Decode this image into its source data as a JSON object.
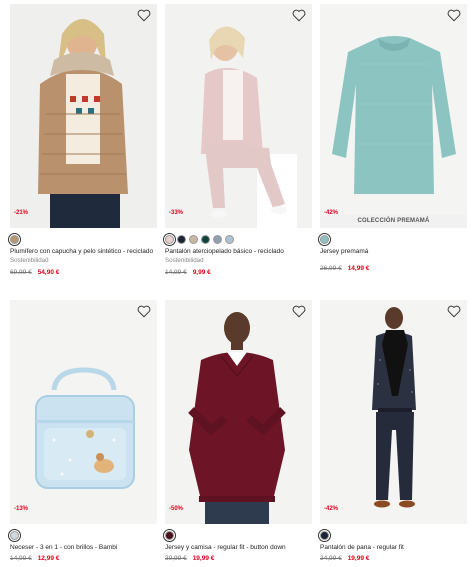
{
  "colors": {
    "sale": "#e3001b",
    "muted": "#888888"
  },
  "products": [
    {
      "name": "Plumífero con capucha y pelo sintético - reciclado",
      "tag": "Sostenibilidad",
      "discount": "-21%",
      "old_price": "69,99 €",
      "new_price": "54,90 €",
      "swatches": [
        "#b99570"
      ],
      "banner": "",
      "icon": "heart-icon"
    },
    {
      "name": "Pantalón aterciopelado básico - reciclado",
      "tag": "Sostenibilidad",
      "discount": "-33%",
      "old_price": "14,99 €",
      "new_price": "9,99 €",
      "swatches": [
        "#e6cfcf",
        "#1b2433",
        "#c7b6a2",
        "#10433f",
        "#8fa0ac",
        "#a9c4d6"
      ],
      "banner": "",
      "icon": "heart-icon"
    },
    {
      "name": "Jersey premamá",
      "tag": "",
      "discount": "-42%",
      "old_price": "26,99 €",
      "new_price": "14,99 €",
      "swatches": [
        "#8fc3c2"
      ],
      "banner": "COLECCIÓN PREMAMÁ",
      "icon": "heart-icon"
    },
    {
      "name": "Neceser - 3 en 1 - con brillos - Bambi",
      "tag": "",
      "discount": "-13%",
      "old_price": "14,99 €",
      "new_price": "12,99 €",
      "swatches": [
        "#cfd8dc"
      ],
      "banner": "",
      "icon": "heart-icon"
    },
    {
      "name": "Jersey y camisa - regular fit - button down",
      "tag": "",
      "discount": "-50%",
      "old_price": "39,99 €",
      "new_price": "19,99 €",
      "swatches": [
        "#4a0f1c"
      ],
      "banner": "",
      "icon": "heart-icon"
    },
    {
      "name": "Pantalón de pana - regular fit",
      "tag": "",
      "discount": "-42%",
      "old_price": "34,99 €",
      "new_price": "19,99 €",
      "swatches": [
        "#1b2433"
      ],
      "banner": "",
      "icon": "heart-icon"
    }
  ]
}
